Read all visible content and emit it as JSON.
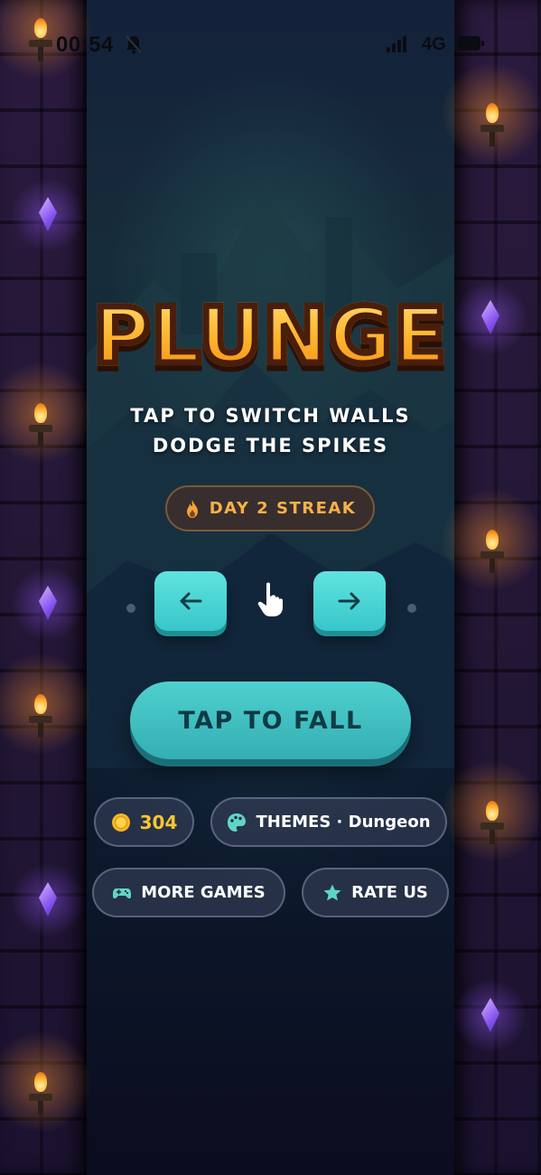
{
  "status_bar": {
    "time": "00:54",
    "network": "4G",
    "bell_icon": "bell-slash-icon",
    "signal_icon": "signal-icon",
    "battery_icon": "battery-icon"
  },
  "game": {
    "title": "PLUNGE",
    "subtitle_line1": "TAP TO SWITCH WALLS",
    "subtitle_line2": "DODGE THE SPIKES",
    "streak_label": "DAY 2 STREAK",
    "tap_label": "TAP TO FALL"
  },
  "controls": {
    "left_icon": "arrow-left-icon",
    "right_icon": "arrow-right-icon",
    "hand_icon": "tap-hand-icon"
  },
  "menu": {
    "coins": "304",
    "themes_label": "THEMES · Dungeon",
    "more_games_label": "MORE GAMES",
    "rate_us_label": "RATE US"
  },
  "colors": {
    "title_gold": "#ffb52e",
    "accent_teal": "#38c6c9",
    "streak_text": "#f5b247",
    "coin_gold": "#f9c531"
  }
}
